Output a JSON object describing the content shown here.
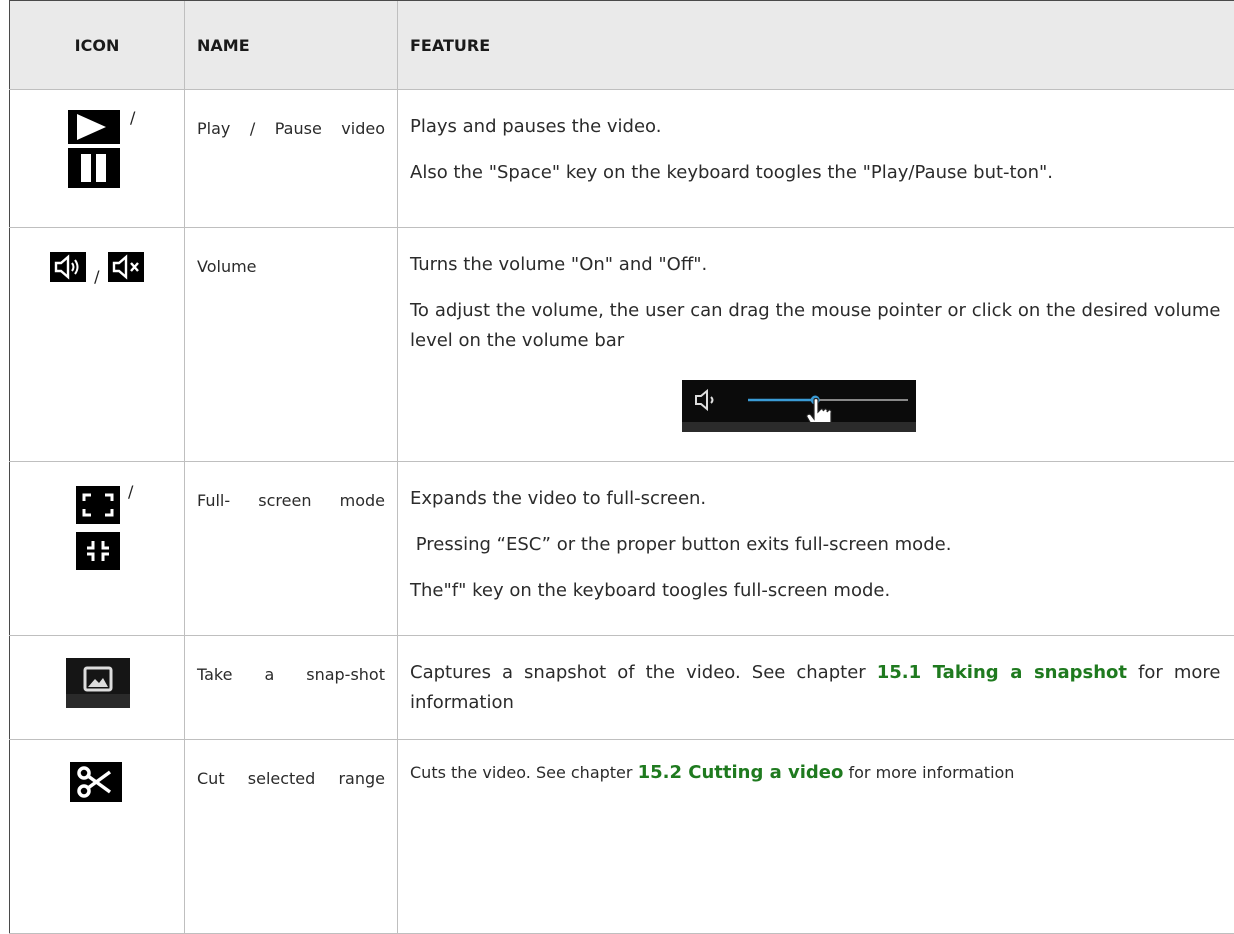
{
  "headers": {
    "icon": "ICON",
    "name": "NAME",
    "feature": "FEATURE"
  },
  "separator": "/",
  "rows": [
    {
      "icons": [
        "play-icon",
        "pause-icon"
      ],
      "name": "Play / Pause video",
      "features": [
        "Plays and pauses the video.",
        "Also the \"Space\" key on the keyboard toogles the \"Play/Pause but-ton\"."
      ]
    },
    {
      "icons": [
        "volume-on-icon",
        "volume-off-icon"
      ],
      "name": "Volume",
      "features": [
        "Turns the volume \"On\" and \"Off\".",
        "To adjust the volume, the user can drag the mouse pointer or click on the desired volume level on the volume bar"
      ],
      "volume_demo_level": 0.42
    },
    {
      "icons": [
        "fullscreen-enter-icon",
        "fullscreen-exit-icon"
      ],
      "name": "Full- screen mode",
      "features": [
        "Expands the video to full-screen.",
        " Pressing “ESC” or the proper button exits full-screen mode.",
        "The\"f\" key on the keyboard toogles full-screen mode."
      ]
    },
    {
      "icons": [
        "snapshot-icon"
      ],
      "name": "Take a snap-shot",
      "features_before": "Captures a snapshot of the video. See chapter ",
      "features_link": "15.1 Taking a snapshot",
      "features_after": " for more information"
    },
    {
      "icons": [
        "scissors-icon"
      ],
      "name": "Cut selected range",
      "features_before": "Cuts the video. See chapter ",
      "features_link": "15.2 Cutting a video",
      "features_after": " for more information"
    }
  ],
  "colors": {
    "link": "#1f7a1f",
    "header_bg": "#eaeaea",
    "volume_accent": "#3a9bd5"
  }
}
